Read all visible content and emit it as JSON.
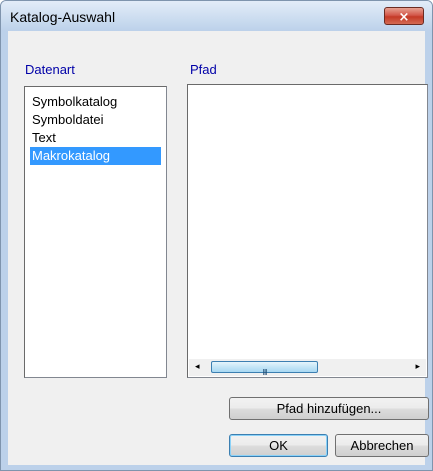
{
  "window": {
    "title": "Katalog-Auswahl",
    "close_glyph": "×"
  },
  "datenart": {
    "label": "Datenart",
    "items": [
      {
        "label": "Symbolkatalog",
        "selected": false
      },
      {
        "label": "Symboldatei",
        "selected": false
      },
      {
        "label": "Text",
        "selected": false
      },
      {
        "label": "Makrokatalog",
        "selected": true
      }
    ]
  },
  "pfad": {
    "label": "Pfad",
    "scroll_left_glyph": "◂",
    "scroll_right_glyph": "▸",
    "thumb_grip": "III"
  },
  "buttons": {
    "add_path": "Pfad hinzufügen...",
    "ok": "OK",
    "cancel": "Abbrechen"
  },
  "colors": {
    "selection": "#3399ff",
    "label_text": "#0000a8",
    "close_button": "#c43926"
  }
}
